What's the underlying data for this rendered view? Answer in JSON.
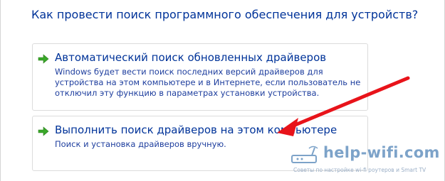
{
  "dialog": {
    "question": "Как провести поиск программного обеспечения для устройств?"
  },
  "options": [
    {
      "title": "Автоматический поиск обновленных драйверов",
      "description": "Windows будет вести поиск последних версий драйверов для устройства на этом компьютере и в Интернете, если пользователь не отключил эту функцию в параметрах установки устройства."
    },
    {
      "title": "Выполнить поиск драйверов на этом компьютере",
      "description": "Поиск и установка драйверов вручную."
    }
  ],
  "watermark": {
    "site": "help-wifi.com",
    "tagline": "Советы по настройке wi-fi роутеров и Smart TV"
  },
  "icons": {
    "option_arrow": "green-arrow-icon",
    "annotation": "red-pointer-arrow",
    "watermark": "router-icon"
  },
  "colors": {
    "link_text": "#003399",
    "arrow_green": "#3aa829",
    "annotation_red": "#e8131a"
  }
}
